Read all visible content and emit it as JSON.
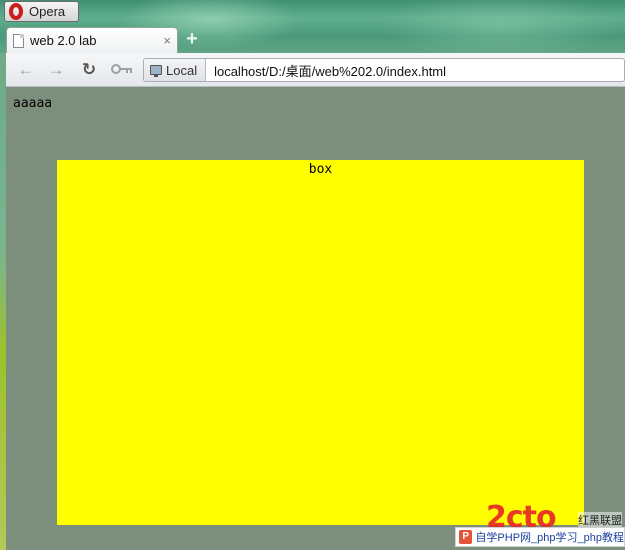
{
  "window": {
    "opera_button_label": "Opera"
  },
  "tab": {
    "title": "web 2.0 lab",
    "close_glyph": "×",
    "new_tab_glyph": "+"
  },
  "toolbar": {
    "back_icon": "back-arrow-icon",
    "forward_icon": "forward-arrow-icon",
    "reload_icon": "reload-icon",
    "key_icon": "key-icon",
    "address_badge": "Local",
    "url": "localhost/D:/桌面/web%202.0/index.html"
  },
  "page": {
    "body_text": "aaaaa",
    "box_text": "box",
    "box_color": "#ffff00",
    "background_color": "#7b8f7c"
  },
  "watermark": {
    "logo_text": "2cto",
    "side_text": "红黑联盟",
    "bar_text": "自学PHP网_php学习_php教程"
  }
}
